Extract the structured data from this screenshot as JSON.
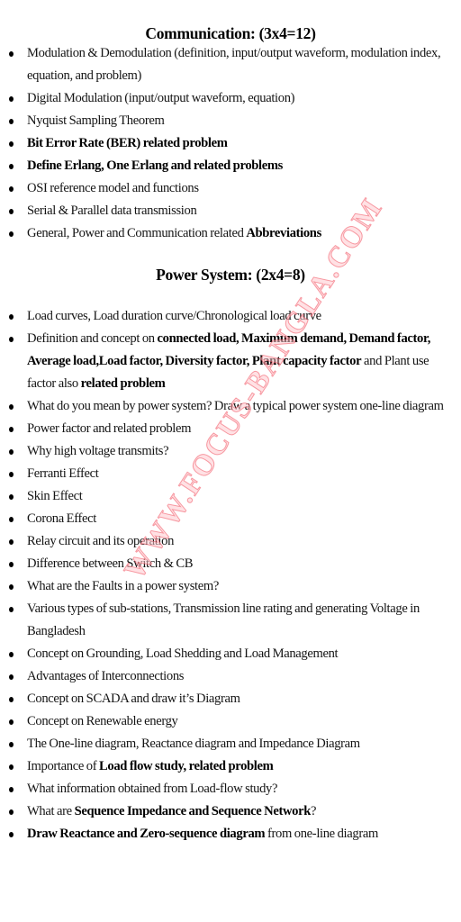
{
  "sections": [
    {
      "title": "Communication: (3x4=12)",
      "items": [
        [
          {
            "t": "Modulation & Demodulation (definition, input/output waveform, modulation index, equation, and problem)",
            "b": false
          }
        ],
        [
          {
            "t": "Digital Modulation (input/output waveform, equation)",
            "b": false
          }
        ],
        [
          {
            "t": "Nyquist Sampling Theorem",
            "b": false
          }
        ],
        [
          {
            "t": "Bit Error Rate (BER) related problem",
            "b": true
          }
        ],
        [
          {
            "t": "Define Erlang, One Erlang and related problems",
            "b": true
          }
        ],
        [
          {
            "t": "OSI reference model and functions",
            "b": false
          }
        ],
        [
          {
            "t": "Serial & Parallel data transmission",
            "b": false
          }
        ],
        [
          {
            "t": "General, Power and Communication related  ",
            "b": false
          },
          {
            "t": "Abbreviations",
            "b": true
          }
        ]
      ]
    },
    {
      "title": "Power System: (2x4=8)",
      "items": [
        [
          {
            "t": "Load curves, Load duration curve/Chronological load curve",
            "b": false
          }
        ],
        [
          {
            "t": "Definition and concept on ",
            "b": false
          },
          {
            "t": "connected load, Maximum demand, Demand factor, Average load,Load factor, Diversity factor, Plant capacity factor",
            "b": true
          },
          {
            "t": " and Plant use factor also ",
            "b": false
          },
          {
            "t": "related problem",
            "b": true
          }
        ],
        [
          {
            "t": "What do you mean by power system? Draw a typical power system one-line diagram",
            "b": false
          }
        ],
        [
          {
            "t": "Power factor and related problem",
            "b": false
          }
        ],
        [
          {
            "t": "Why high voltage transmits?",
            "b": false
          }
        ],
        [
          {
            "t": "Ferranti Effect",
            "b": false
          }
        ],
        [
          {
            "t": "Skin Effect",
            "b": false
          }
        ],
        [
          {
            "t": "Corona Effect",
            "b": false
          }
        ],
        [
          {
            "t": "Relay circuit and its operation",
            "b": false
          }
        ],
        [
          {
            "t": "Difference between Switch & CB",
            "b": false
          }
        ],
        [
          {
            "t": "What are the Faults in a power system?",
            "b": false
          }
        ],
        [
          {
            "t": "Various types of sub-stations, Transmission line rating and generating Voltage in Bangladesh",
            "b": false
          }
        ],
        [
          {
            "t": "Concept on Grounding, Load Shedding and Load Management",
            "b": false
          }
        ],
        [
          {
            "t": "Advantages of Interconnections",
            "b": false
          }
        ],
        [
          {
            "t": "Concept on SCADA and draw it’s Diagram",
            "b": false
          }
        ],
        [
          {
            "t": "Concept on Renewable energy",
            "b": false
          }
        ],
        [
          {
            "t": "The One-line diagram, Reactance diagram and Impedance Diagram",
            "b": false
          }
        ],
        [
          {
            "t": "Importance of ",
            "b": false
          },
          {
            "t": "Load flow study, related problem",
            "b": true
          }
        ],
        [
          {
            "t": "What information obtained from Load-flow study?",
            "b": false
          }
        ],
        [
          {
            "t": "What are ",
            "b": false
          },
          {
            "t": "Sequence Impedance and Sequence Network",
            "b": true
          },
          {
            "t": "?",
            "b": false
          }
        ],
        [
          {
            "t": "Draw Reactance and Zero-sequence diagram",
            "b": true
          },
          {
            "t": " from one-line diagram",
            "b": false
          }
        ]
      ]
    }
  ],
  "watermark": {
    "text": "WWW.FOCUS-BANGLA.COM",
    "color": "#f05060"
  }
}
